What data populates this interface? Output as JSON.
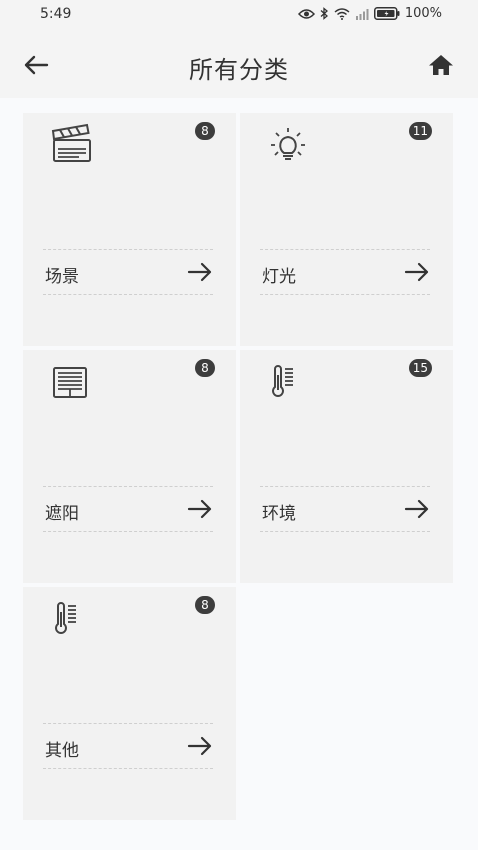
{
  "status_bar": {
    "time": "5:49",
    "battery": "100%",
    "icons": [
      "eye-icon",
      "bluetooth-icon",
      "wifi-icon",
      "signal-icon",
      "battery-icon"
    ]
  },
  "header": {
    "title": "所有分类",
    "back_icon": "back-arrow-icon",
    "home_icon": "home-icon"
  },
  "categories": [
    {
      "label": "场景",
      "count": "8",
      "icon": "clapperboard-icon"
    },
    {
      "label": "灯光",
      "count": "11",
      "icon": "lightbulb-icon"
    },
    {
      "label": "遮阳",
      "count": "8",
      "icon": "blind-icon"
    },
    {
      "label": "环境",
      "count": "15",
      "icon": "thermometer-icon"
    },
    {
      "label": "其他",
      "count": "8",
      "icon": "thermometer-icon"
    }
  ],
  "colors": {
    "background": "#f9fafc",
    "card": "#f2f2f2",
    "badge": "#3d3d3d",
    "text": "#333333"
  }
}
